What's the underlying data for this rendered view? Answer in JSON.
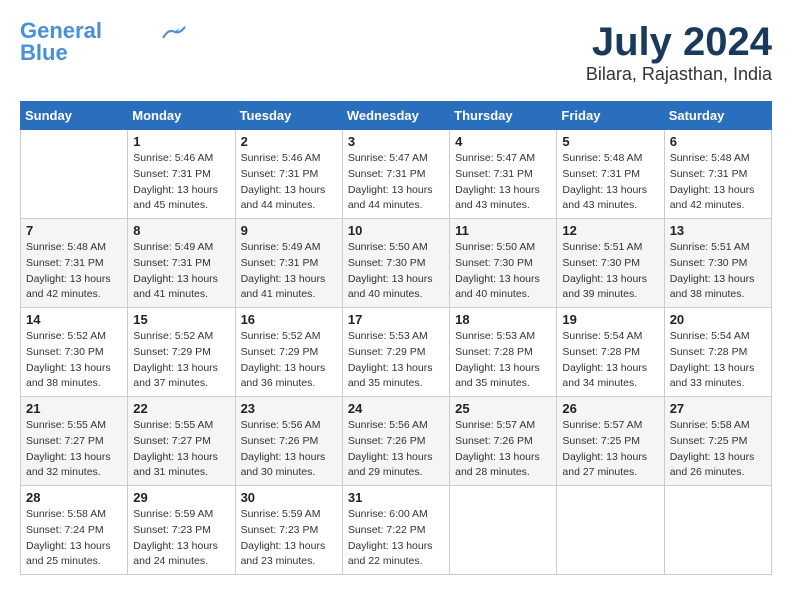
{
  "header": {
    "logo_line1": "General",
    "logo_line2": "Blue",
    "month_year": "July 2024",
    "location": "Bilara, Rajasthan, India"
  },
  "days_of_week": [
    "Sunday",
    "Monday",
    "Tuesday",
    "Wednesday",
    "Thursday",
    "Friday",
    "Saturday"
  ],
  "weeks": [
    [
      {
        "day": "",
        "info": ""
      },
      {
        "day": "1",
        "info": "Sunrise: 5:46 AM\nSunset: 7:31 PM\nDaylight: 13 hours\nand 45 minutes."
      },
      {
        "day": "2",
        "info": "Sunrise: 5:46 AM\nSunset: 7:31 PM\nDaylight: 13 hours\nand 44 minutes."
      },
      {
        "day": "3",
        "info": "Sunrise: 5:47 AM\nSunset: 7:31 PM\nDaylight: 13 hours\nand 44 minutes."
      },
      {
        "day": "4",
        "info": "Sunrise: 5:47 AM\nSunset: 7:31 PM\nDaylight: 13 hours\nand 43 minutes."
      },
      {
        "day": "5",
        "info": "Sunrise: 5:48 AM\nSunset: 7:31 PM\nDaylight: 13 hours\nand 43 minutes."
      },
      {
        "day": "6",
        "info": "Sunrise: 5:48 AM\nSunset: 7:31 PM\nDaylight: 13 hours\nand 42 minutes."
      }
    ],
    [
      {
        "day": "7",
        "info": "Sunrise: 5:48 AM\nSunset: 7:31 PM\nDaylight: 13 hours\nand 42 minutes."
      },
      {
        "day": "8",
        "info": "Sunrise: 5:49 AM\nSunset: 7:31 PM\nDaylight: 13 hours\nand 41 minutes."
      },
      {
        "day": "9",
        "info": "Sunrise: 5:49 AM\nSunset: 7:31 PM\nDaylight: 13 hours\nand 41 minutes."
      },
      {
        "day": "10",
        "info": "Sunrise: 5:50 AM\nSunset: 7:30 PM\nDaylight: 13 hours\nand 40 minutes."
      },
      {
        "day": "11",
        "info": "Sunrise: 5:50 AM\nSunset: 7:30 PM\nDaylight: 13 hours\nand 40 minutes."
      },
      {
        "day": "12",
        "info": "Sunrise: 5:51 AM\nSunset: 7:30 PM\nDaylight: 13 hours\nand 39 minutes."
      },
      {
        "day": "13",
        "info": "Sunrise: 5:51 AM\nSunset: 7:30 PM\nDaylight: 13 hours\nand 38 minutes."
      }
    ],
    [
      {
        "day": "14",
        "info": "Sunrise: 5:52 AM\nSunset: 7:30 PM\nDaylight: 13 hours\nand 38 minutes."
      },
      {
        "day": "15",
        "info": "Sunrise: 5:52 AM\nSunset: 7:29 PM\nDaylight: 13 hours\nand 37 minutes."
      },
      {
        "day": "16",
        "info": "Sunrise: 5:52 AM\nSunset: 7:29 PM\nDaylight: 13 hours\nand 36 minutes."
      },
      {
        "day": "17",
        "info": "Sunrise: 5:53 AM\nSunset: 7:29 PM\nDaylight: 13 hours\nand 35 minutes."
      },
      {
        "day": "18",
        "info": "Sunrise: 5:53 AM\nSunset: 7:28 PM\nDaylight: 13 hours\nand 35 minutes."
      },
      {
        "day": "19",
        "info": "Sunrise: 5:54 AM\nSunset: 7:28 PM\nDaylight: 13 hours\nand 34 minutes."
      },
      {
        "day": "20",
        "info": "Sunrise: 5:54 AM\nSunset: 7:28 PM\nDaylight: 13 hours\nand 33 minutes."
      }
    ],
    [
      {
        "day": "21",
        "info": "Sunrise: 5:55 AM\nSunset: 7:27 PM\nDaylight: 13 hours\nand 32 minutes."
      },
      {
        "day": "22",
        "info": "Sunrise: 5:55 AM\nSunset: 7:27 PM\nDaylight: 13 hours\nand 31 minutes."
      },
      {
        "day": "23",
        "info": "Sunrise: 5:56 AM\nSunset: 7:26 PM\nDaylight: 13 hours\nand 30 minutes."
      },
      {
        "day": "24",
        "info": "Sunrise: 5:56 AM\nSunset: 7:26 PM\nDaylight: 13 hours\nand 29 minutes."
      },
      {
        "day": "25",
        "info": "Sunrise: 5:57 AM\nSunset: 7:26 PM\nDaylight: 13 hours\nand 28 minutes."
      },
      {
        "day": "26",
        "info": "Sunrise: 5:57 AM\nSunset: 7:25 PM\nDaylight: 13 hours\nand 27 minutes."
      },
      {
        "day": "27",
        "info": "Sunrise: 5:58 AM\nSunset: 7:25 PM\nDaylight: 13 hours\nand 26 minutes."
      }
    ],
    [
      {
        "day": "28",
        "info": "Sunrise: 5:58 AM\nSunset: 7:24 PM\nDaylight: 13 hours\nand 25 minutes."
      },
      {
        "day": "29",
        "info": "Sunrise: 5:59 AM\nSunset: 7:23 PM\nDaylight: 13 hours\nand 24 minutes."
      },
      {
        "day": "30",
        "info": "Sunrise: 5:59 AM\nSunset: 7:23 PM\nDaylight: 13 hours\nand 23 minutes."
      },
      {
        "day": "31",
        "info": "Sunrise: 6:00 AM\nSunset: 7:22 PM\nDaylight: 13 hours\nand 22 minutes."
      },
      {
        "day": "",
        "info": ""
      },
      {
        "day": "",
        "info": ""
      },
      {
        "day": "",
        "info": ""
      }
    ]
  ]
}
